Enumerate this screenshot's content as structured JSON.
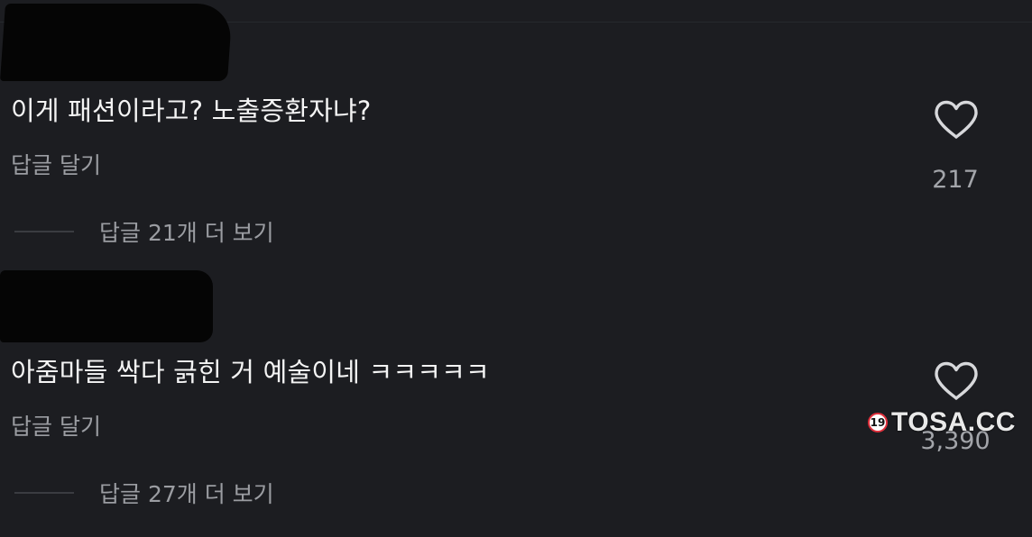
{
  "comments": [
    {
      "text": "이게 패션이라고? 노출증환자냐?",
      "reply_label": "답글 달기",
      "view_replies": "답글 21개 더 보기",
      "like_count": "217",
      "like_icon": "heart-outline-icon"
    },
    {
      "text": "아줌마들 싹다 긁힌 거 예술이네 ㅋㅋㅋㅋㅋ",
      "reply_label": "답글 달기",
      "view_replies": "답글 27개 더 보기",
      "like_count": "3,390",
      "like_icon": "heart-outline-icon"
    }
  ],
  "watermark": {
    "badge": "19",
    "text": "TOSA.CC"
  },
  "colors": {
    "background": "#1c1d21",
    "primary_text": "#f4f4f4",
    "secondary_text": "#9b9da2",
    "redaction": "#050505"
  }
}
